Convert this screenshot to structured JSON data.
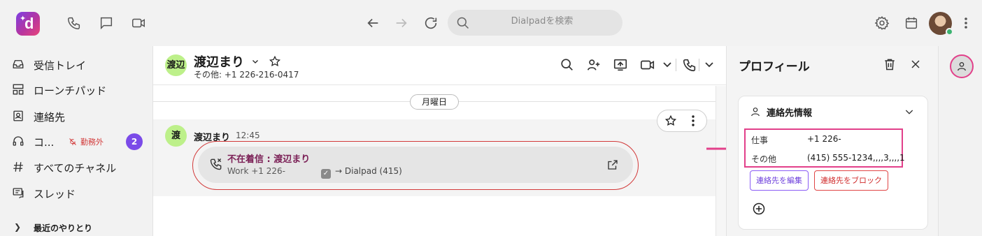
{
  "topbar": {
    "search_placeholder": "Dialpadを検索"
  },
  "sidebar": {
    "items": [
      {
        "label": "受信トレイ",
        "icon": "inbox-icon"
      },
      {
        "label": "ローンチパッド",
        "icon": "launchpad-icon"
      },
      {
        "label": "連絡先",
        "icon": "contacts-icon"
      },
      {
        "label": "コ...",
        "icon": "headset-icon",
        "status": "勤務外",
        "count": "2"
      },
      {
        "label": "すべてのチャネル",
        "icon": "hash-icon"
      },
      {
        "label": "スレッド",
        "icon": "threads-icon"
      }
    ],
    "recent_label": "最近のやりとり"
  },
  "conversation": {
    "avatar_text": "渡辺",
    "name": "渡辺まり",
    "subtitle": "その他: +1 226-216-0417",
    "day_label": "月曜日",
    "message": {
      "avatar_text": "渡",
      "sender": "渡辺まり",
      "time": "12:45",
      "title": "不在着信 : 渡辺まり",
      "from": "Work +1 226-",
      "routed_to": "→ Dialpad (415)"
    }
  },
  "profile": {
    "title": "プロフィール",
    "card_title": "連絡先情報",
    "rows": [
      {
        "label": "仕事",
        "value": "+1 226-"
      },
      {
        "label": "その他",
        "value": "(415) 555-1234,,,,3,,,,1"
      }
    ],
    "edit_button": "連絡先を編集",
    "block_button": "連絡先をブロック"
  },
  "colors": {
    "accent_purple": "#7b4be8",
    "highlight_pink": "#e2408a",
    "missed_call": "#7a1e55",
    "alert_red": "#d23a3a",
    "avatar_green": "#bdf08a"
  }
}
